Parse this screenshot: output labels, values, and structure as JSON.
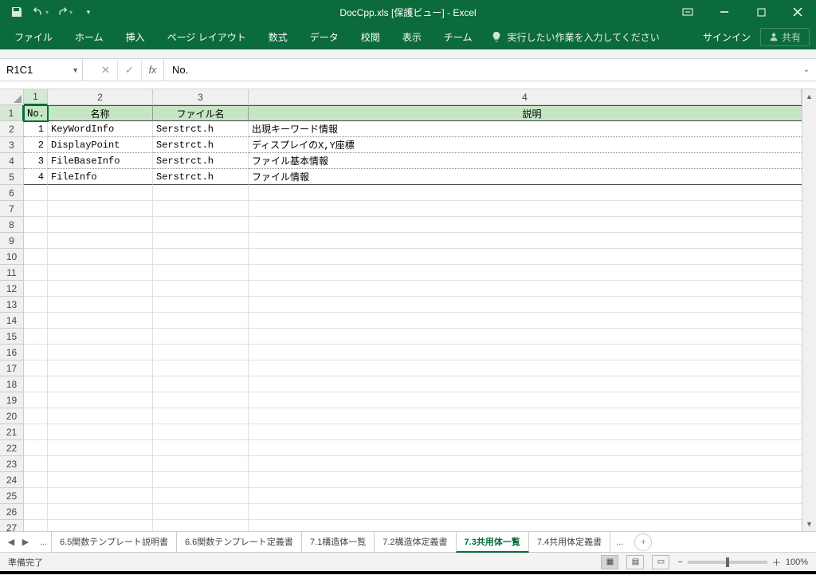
{
  "titlebar": {
    "title": "DocCpp.xls  [保護ビュー] - Excel"
  },
  "ribbon": {
    "tabs": [
      "ファイル",
      "ホーム",
      "挿入",
      "ページ レイアウト",
      "数式",
      "データ",
      "校閲",
      "表示",
      "チーム"
    ],
    "tell": "実行したい作業を入力してください",
    "signin": "サインイン",
    "share": "共有"
  },
  "formula": {
    "namebox": "R1C1",
    "value": "No."
  },
  "grid": {
    "col_headers": [
      "1",
      "2",
      "3",
      "4"
    ],
    "row_headers": [
      1,
      2,
      3,
      4,
      5,
      6,
      7,
      8,
      9,
      10,
      11,
      12,
      13,
      14,
      15,
      16,
      17,
      18,
      19,
      20,
      21,
      22,
      23,
      24,
      25,
      26,
      27
    ],
    "header_row": [
      "No.",
      "名称",
      "ファイル名",
      "説明"
    ],
    "rows": [
      {
        "no": "1",
        "name": "KeyWordInfo",
        "file": "Serstrct.h",
        "desc": "出現キーワード情報"
      },
      {
        "no": "2",
        "name": "DisplayPoint",
        "file": "Serstrct.h",
        "desc": "ディスプレイのX,Y座標"
      },
      {
        "no": "3",
        "name": "FileBaseInfo",
        "file": "Serstrct.h",
        "desc": "ファイル基本情報"
      },
      {
        "no": "4",
        "name": "FileInfo",
        "file": "Serstrct.h",
        "desc": "ファイル情報"
      }
    ]
  },
  "sheets": {
    "tabs": [
      "6.5関数テンプレート説明書",
      "6.6関数テンプレート定義書",
      "7.1構造体一覧",
      "7.2構造体定義書",
      "7.3共用体一覧",
      "7.4共用体定義書"
    ],
    "active": 4
  },
  "status": {
    "ready": "準備完了",
    "zoom": "100%"
  }
}
